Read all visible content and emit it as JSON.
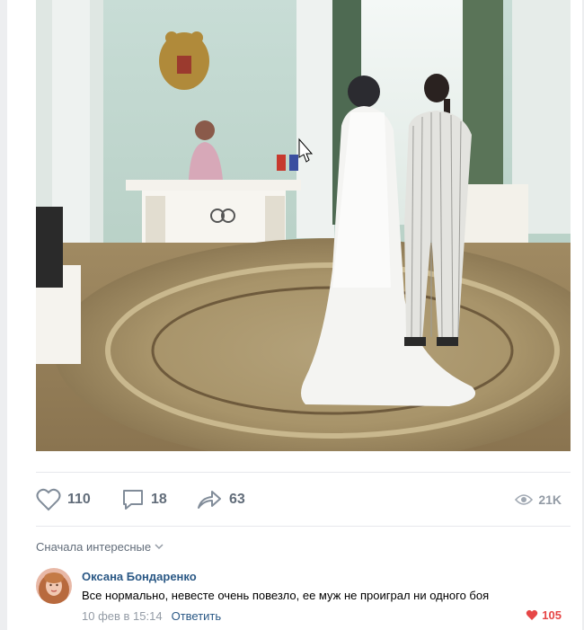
{
  "post": {
    "likes": "110",
    "comments": "18",
    "shares": "63",
    "views": "21K"
  },
  "comments_section": {
    "sort_label": "Сначала интересные",
    "comment": {
      "author": "Оксана Бондаренко",
      "text": "Все нормально, невесте очень повезло, ее муж не проиграл ни одного боя",
      "timestamp": "10 фев в 15:14",
      "reply_label": "Ответить",
      "likes": "105"
    }
  },
  "icons": [
    "heart-icon",
    "comment-icon",
    "share-icon",
    "eye-icon",
    "chevron-down-icon",
    "heart-filled-icon"
  ],
  "colors": {
    "link": "#2a5885",
    "muted": "#626d7a",
    "like_red": "#e64646"
  }
}
